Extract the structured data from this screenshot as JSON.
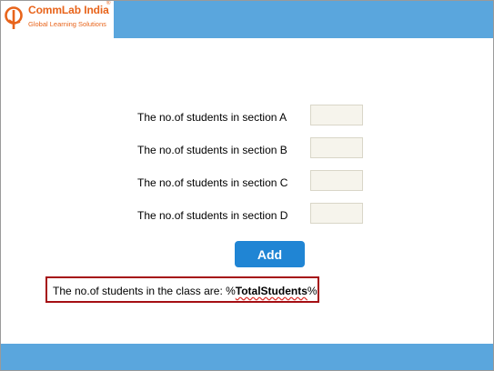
{
  "header": {
    "logo_name": "CommLab India",
    "logo_registered": "®",
    "logo_tagline": "Global Learning Solutions"
  },
  "form": {
    "rows": [
      {
        "label": "The no.of students in section A",
        "value": ""
      },
      {
        "label": "The no.of students in section B",
        "value": ""
      },
      {
        "label": "The no.of students in section C",
        "value": ""
      },
      {
        "label": "The no.of students in section D",
        "value": ""
      }
    ],
    "add_label": "Add"
  },
  "result": {
    "prefix": "The no.of students in the class are: ",
    "var_open": "%",
    "variable": "TotalStudents",
    "var_close": "%"
  },
  "colors": {
    "bar": "#5aa6dd",
    "button": "#2085d4",
    "logo": "#e8641b",
    "result_border": "#a50f14"
  }
}
